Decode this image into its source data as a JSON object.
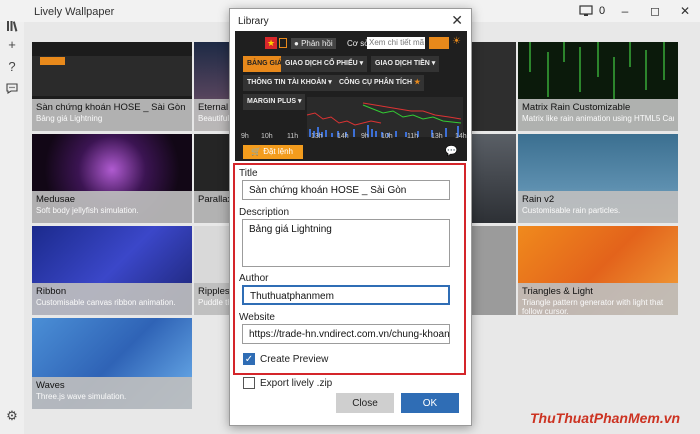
{
  "app": {
    "title": "Lively Wallpaper",
    "monitor_count": "0"
  },
  "tiles": [
    {
      "title": "Sàn chứng khoán HOSE _ Sài Gòn",
      "desc": "Bảng giá Lightning"
    },
    {
      "title": "Eternal Li",
      "desc": "Beautiful s"
    },
    {
      "title": "",
      "desc": ""
    },
    {
      "title": "Matrix Rain Customizable",
      "desc": "Matrix like rain animation using HTML5 Canvas."
    },
    {
      "title": "Medusae",
      "desc": "Soft body jellyfish simulation."
    },
    {
      "title": "Parallax.js",
      "desc": ""
    },
    {
      "title": "Rain v2",
      "desc": "Customisable rain particles."
    },
    {
      "title": "Ribbon",
      "desc": "Customisable canvas ribbon animation."
    },
    {
      "title": "Ripples",
      "desc": "Puddle tha"
    },
    {
      "title": "Triangles & Light",
      "desc": "Triangle pattern generator with light that follow cursor."
    },
    {
      "title": "Waves",
      "desc": "Three.js wave simulation."
    }
  ],
  "preview": {
    "feedback": "Phản hồi",
    "co_so": "Cơ sở",
    "search_placeholder": "Xem chi tiết mã",
    "menu": [
      "BẢNG GIÁ",
      "GIAO DỊCH CỔ PHIẾU",
      "GIAO DỊCH TIỀN",
      "THÔNG TIN TÀI KHOẢN",
      "CÔNG CỤ PHÂN TÍCH",
      "MARGIN PLUS"
    ],
    "x_ticks": [
      "9h",
      "10h",
      "11h",
      "13h",
      "14h",
      "9h",
      "10h",
      "11h",
      "13h",
      "14h"
    ],
    "order_button": "Đặt lệnh"
  },
  "dialog": {
    "title": "Library",
    "title_label": "Title",
    "title_value": "Sàn chứng khoán HOSE _ Sài Gòn",
    "description_label": "Description",
    "description_value": "Bảng giá Lightning",
    "author_label": "Author",
    "author_value": "Thuthuatphanmem",
    "website_label": "Website",
    "website_value": "https://trade-hn.vndirect.com.vn/chung-khoan/hose",
    "create_preview_label": "Create Preview",
    "create_preview_checked": true,
    "export_label": "Export lively .zip",
    "export_checked": false,
    "close_label": "Close",
    "ok_label": "OK"
  },
  "watermark": "ThuThuatPhanMem.vn",
  "colors": {
    "accent": "#2f6db5",
    "highlight_border": "#d4252a",
    "order_button": "#f39c1d"
  }
}
